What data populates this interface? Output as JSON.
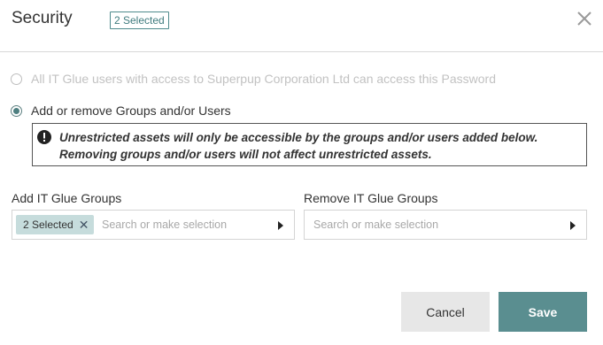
{
  "modal": {
    "title": "Security",
    "selected_badge": "2 Selected",
    "close_icon": "close-icon"
  },
  "access": {
    "option_all_label": "All IT Glue users with access to Superpup Corporation Ltd can access this Password",
    "option_all_selected": false,
    "option_all_disabled": true,
    "option_groups_label": "Add or remove Groups and/or Users",
    "option_groups_selected": true
  },
  "alert": {
    "icon": "exclamation-circle-icon",
    "line1": "Unrestricted assets will only be accessible by the groups and/or users added below.",
    "line2": "Removing groups and/or users will not affect unrestricted assets."
  },
  "add_groups": {
    "label": "Add IT Glue Groups",
    "chip": "2 Selected",
    "placeholder": "Search or make selection"
  },
  "remove_groups": {
    "label": "Remove IT Glue Groups",
    "placeholder": "Search or make selection"
  },
  "buttons": {
    "cancel": "Cancel",
    "save": "Save"
  },
  "colors": {
    "accent": "#5a8e90",
    "chip_bg": "#c6dcdc",
    "cancel_bg": "#e7e7e7"
  }
}
